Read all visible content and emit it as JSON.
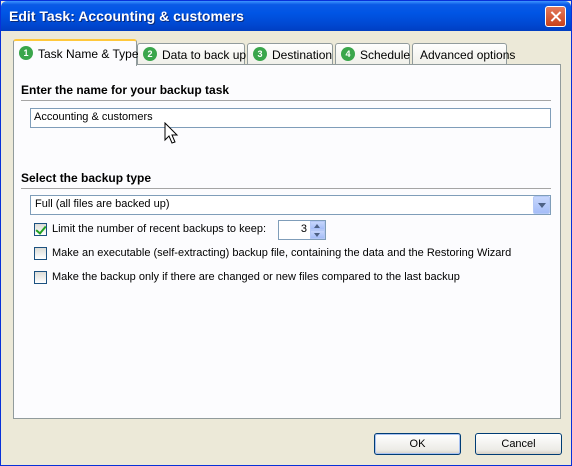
{
  "window": {
    "title": "Edit Task: Accounting & customers"
  },
  "tabs": [
    {
      "num": "1",
      "label": "Task Name & Type"
    },
    {
      "num": "2",
      "label": "Data to back up"
    },
    {
      "num": "3",
      "label": "Destination"
    },
    {
      "num": "4",
      "label": "Schedule"
    },
    {
      "label": "Advanced options"
    }
  ],
  "name_section": {
    "title": "Enter the name for your backup task",
    "value": "Accounting & customers"
  },
  "type_section": {
    "title": "Select the backup type",
    "selected": "Full (all files are backed up)"
  },
  "options": {
    "limit": {
      "label": "Limit the number of recent backups to keep:",
      "checked": true,
      "value": "3"
    },
    "executable": {
      "label": "Make an executable (self-extracting) backup file, containing the data and the Restoring Wizard",
      "checked": false
    },
    "changed_only": {
      "label": "Make the backup only if there are changed or new files compared to the last backup",
      "checked": false
    }
  },
  "buttons": {
    "ok": "OK",
    "cancel": "Cancel"
  },
  "icons": {
    "close": "close-icon",
    "dropdown": "chevron-down-icon",
    "cursor": "mouse-cursor-icon"
  },
  "colors": {
    "titlebar": "#0055e5",
    "tab_badge": "#3aa64b",
    "active_tab_accent": "#ffc83c"
  }
}
